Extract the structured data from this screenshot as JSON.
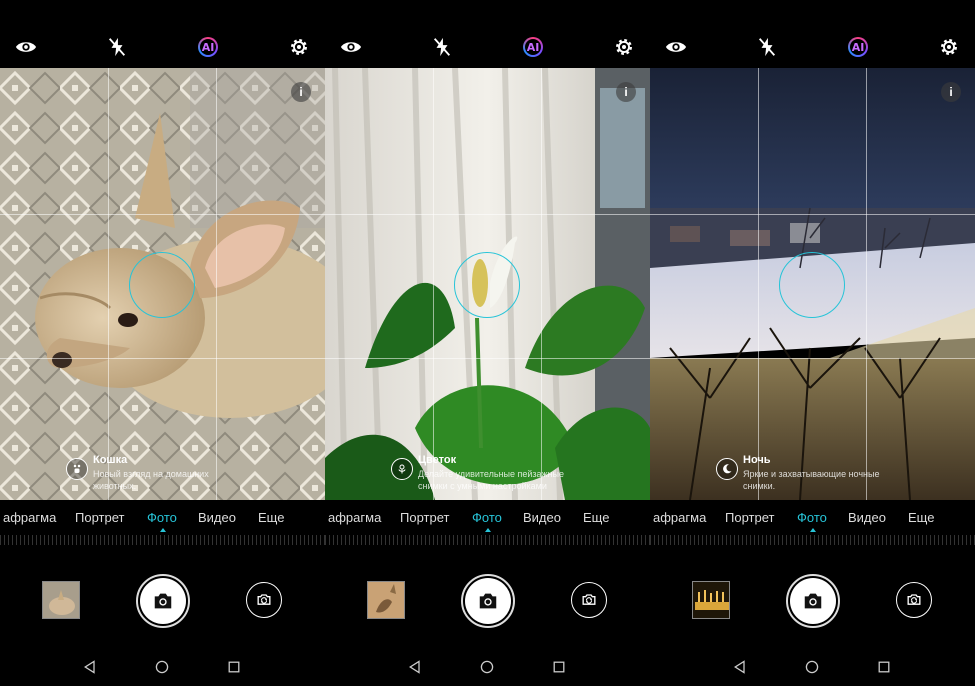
{
  "top_icons": [
    "eye-icon",
    "flash-off-icon",
    "ai-icon",
    "gear-icon"
  ],
  "ai_label": "AI",
  "info_label": "i",
  "screens": [
    {
      "scene_title": "Кошка",
      "scene_desc": "Новый взгляд на домашних животных.",
      "scene_icon": "pet-icon",
      "modes": [
        "афрагма",
        "Портрет",
        "Фото",
        "Видео",
        "Еще"
      ],
      "active_mode": "Фото"
    },
    {
      "scene_title": "Цветок",
      "scene_desc": "Делайте удивительные пейзажные снимки с умными настройками",
      "scene_icon": "flower-icon",
      "modes": [
        "афрагма",
        "Портрет",
        "Фото",
        "Видео",
        "Еще"
      ],
      "active_mode": "Фото"
    },
    {
      "scene_title": "Ночь",
      "scene_desc": "Яркие и захватывающие ночные снимки.",
      "scene_icon": "moon-icon",
      "modes": [
        "афрагма",
        "Портрет",
        "Фото",
        "Видео",
        "Еще"
      ],
      "active_mode": "Фото"
    }
  ],
  "colors": {
    "accent": "#27c4d8",
    "background": "#000000"
  }
}
